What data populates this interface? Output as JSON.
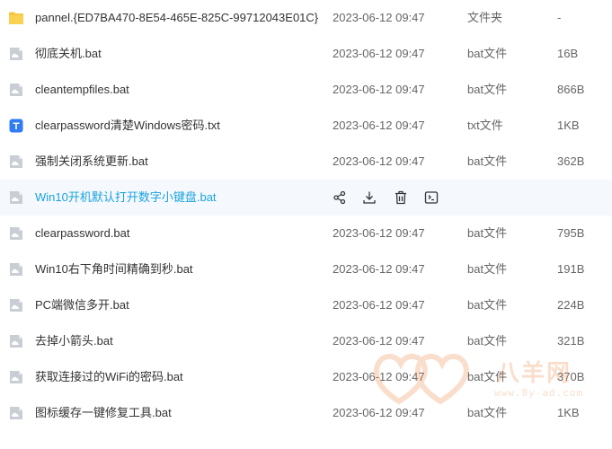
{
  "columns_example": "name / modified / type / size",
  "files": [
    {
      "name": "pannel.{ED7BA470-8E54-465E-825C-99712043E01C}",
      "modified": "2023-06-12 09:47",
      "type": "文件夹",
      "size": "-",
      "icon": "folder-icon"
    },
    {
      "name": "彻底关机.bat",
      "modified": "2023-06-12 09:47",
      "type": "bat文件",
      "size": "16B",
      "icon": "bat-file-icon"
    },
    {
      "name": "cleantempfiles.bat",
      "modified": "2023-06-12 09:47",
      "type": "bat文件",
      "size": "866B",
      "icon": "bat-file-icon"
    },
    {
      "name": "clearpassword清楚Windows密码.txt",
      "modified": "2023-06-12 09:47",
      "type": "txt文件",
      "size": "1KB",
      "icon": "txt-file-icon"
    },
    {
      "name": "强制关闭系统更新.bat",
      "modified": "2023-06-12 09:47",
      "type": "bat文件",
      "size": "362B",
      "icon": "bat-file-icon"
    },
    {
      "name": "Win10开机默认打开数字小键盘.bat",
      "modified": "",
      "type": "",
      "size": "",
      "icon": "bat-file-icon",
      "hovered": true
    },
    {
      "name": "clearpassword.bat",
      "modified": "2023-06-12 09:47",
      "type": "bat文件",
      "size": "795B",
      "icon": "bat-file-icon"
    },
    {
      "name": "Win10右下角时间精确到秒.bat",
      "modified": "2023-06-12 09:47",
      "type": "bat文件",
      "size": "191B",
      "icon": "bat-file-icon"
    },
    {
      "name": "PC端微信多开.bat",
      "modified": "2023-06-12 09:47",
      "type": "bat文件",
      "size": "224B",
      "icon": "bat-file-icon"
    },
    {
      "name": "去掉小箭头.bat",
      "modified": "2023-06-12 09:47",
      "type": "bat文件",
      "size": "321B",
      "icon": "bat-file-icon"
    },
    {
      "name": "获取连接过的WiFi的密码.bat",
      "modified": "2023-06-12 09:47",
      "type": "bat文件",
      "size": "370B",
      "icon": "bat-file-icon"
    },
    {
      "name": "图标缓存一键修复工具.bat",
      "modified": "2023-06-12 09:47",
      "type": "bat文件",
      "size": "1KB",
      "icon": "bat-file-icon"
    }
  ],
  "hover_actions": [
    {
      "icon": "share-icon"
    },
    {
      "icon": "download-icon"
    },
    {
      "icon": "delete-icon"
    },
    {
      "icon": "rename-icon"
    }
  ],
  "watermark": {
    "brand": "八羊网",
    "url": "www.8y-ad.com"
  },
  "colors": {
    "folder": "#f7c640",
    "file_icon": "#c9cdd4",
    "txt_icon": "#2f7cf6",
    "hover_text": "#1aa3e0",
    "hover_row": "#f5f8fd",
    "text": "#333333",
    "meta_text": "#666666"
  }
}
